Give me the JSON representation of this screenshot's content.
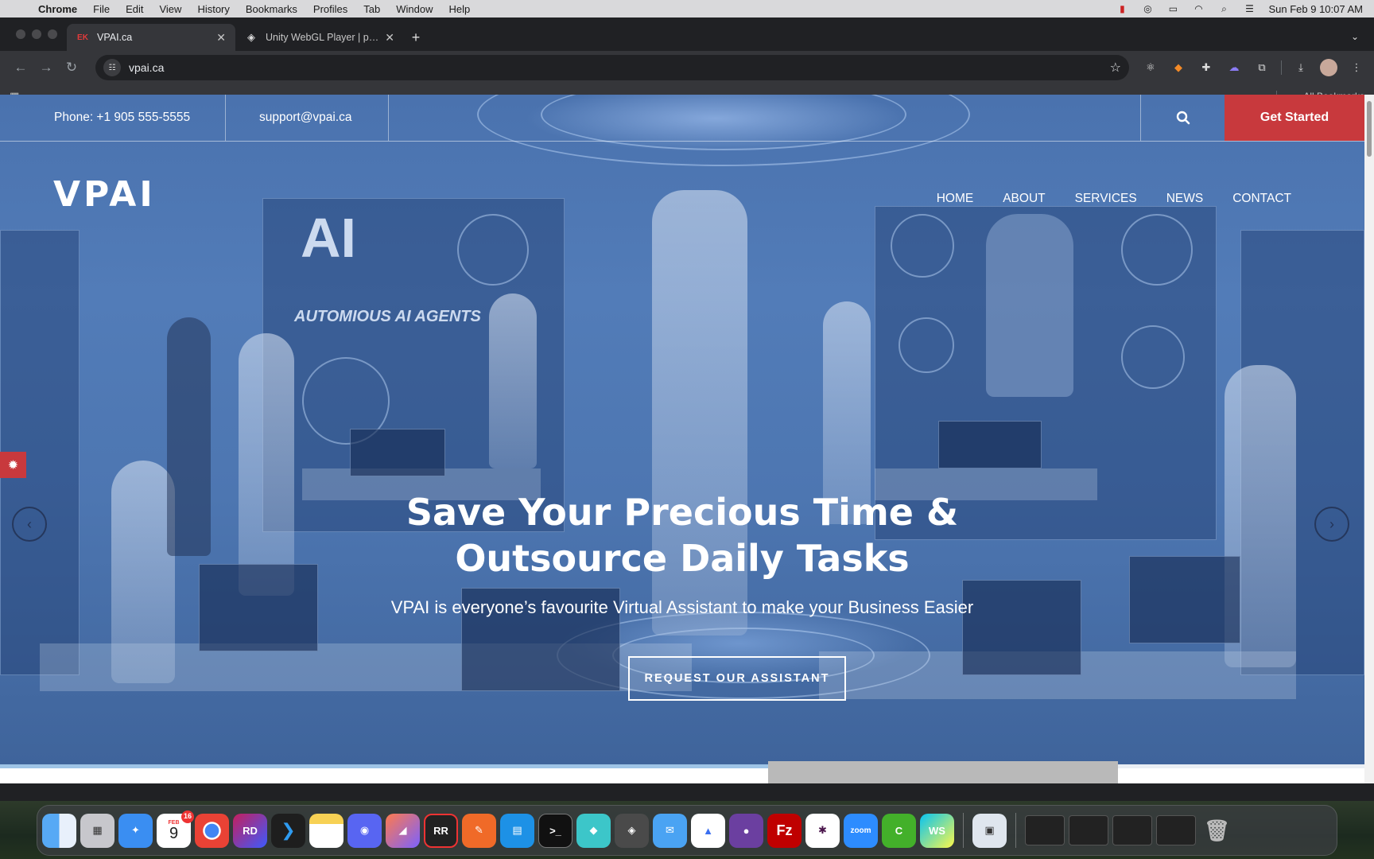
{
  "menubar": {
    "app": "Chrome",
    "items": [
      "File",
      "Edit",
      "View",
      "History",
      "Bookmarks",
      "Profiles",
      "Tab",
      "Window",
      "Help"
    ],
    "datetime": "Sun Feb 9  10:07 AM"
  },
  "tabs": [
    {
      "title": "VPAI.ca",
      "favicon": "vp-favicon"
    },
    {
      "title": "Unity WebGL Player | prospec",
      "favicon": "unity-icon"
    }
  ],
  "omnibox": {
    "url": "vpai.ca"
  },
  "bookmarks": {
    "all_label": "All Bookmarks"
  },
  "site": {
    "phone": "Phone: +1 905 555-5555",
    "email": "support@vpai.ca",
    "get_started": "Get Started",
    "logo": "VPAI",
    "nav": [
      "HOME",
      "ABOUT",
      "SERVICES",
      "NEWS",
      "CONTACT"
    ],
    "headline_line1": "Save Your Precious Time &",
    "headline_line2": "Outsource Daily Tasks",
    "subline": "VPAI is everyone’s favourite Virtual Assistant to make your Business Easier",
    "cta": "REQUEST OUR ASSISTANT",
    "hero_text_ai": "AI",
    "hero_text_agents": "AUTOMIOUS AI AGENTS",
    "slider_progress": 0.78,
    "accent": "#c8393d"
  },
  "dock": {
    "calendar_month": "FEB",
    "calendar_day": "9",
    "calendar_badge": "16",
    "apps": [
      "Finder",
      "Launchpad",
      "Safari",
      "Calendar",
      "Chrome",
      "Rider",
      "VS Code",
      "Notes",
      "Discord",
      "Affinity",
      "RR",
      "Pen",
      "Docker",
      "Terminal",
      "Cube",
      "Unity",
      "Mail",
      "Nord",
      "GitHub",
      "FileZilla",
      "Slack",
      "Zoom",
      "Camo",
      "WebStorm",
      "Preview"
    ]
  }
}
